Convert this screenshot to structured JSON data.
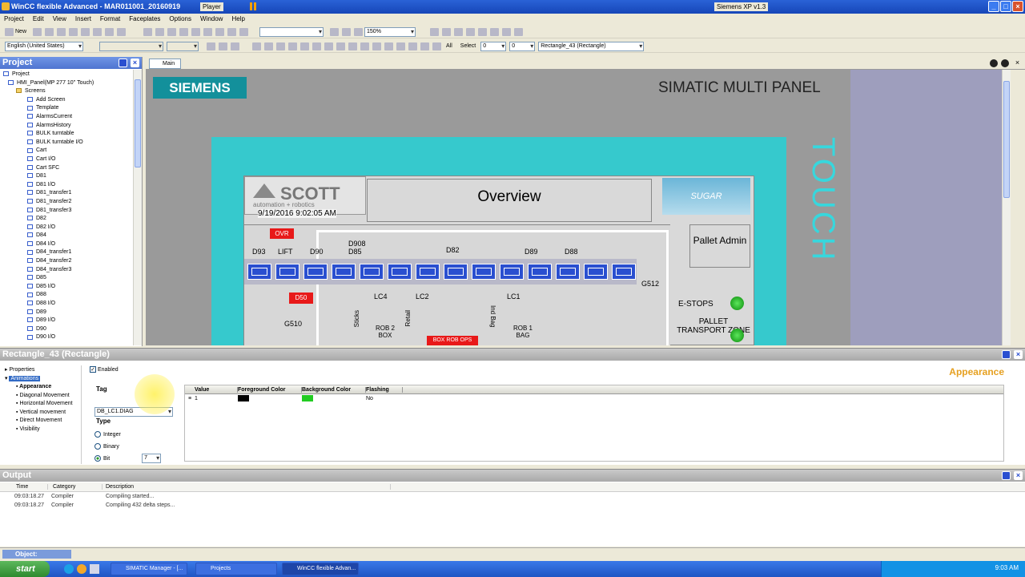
{
  "window": {
    "title": "WinCC flexible Advanced - MAR011001_20160919",
    "player_label": "Player",
    "right_title": "Siemens XP v1.3"
  },
  "menu": [
    "Project",
    "Edit",
    "View",
    "Insert",
    "Format",
    "Faceplates",
    "Options",
    "Window",
    "Help"
  ],
  "toolbar": {
    "new_label": "New",
    "zoom": "150%",
    "language": "English (United States)",
    "select_label": "Select",
    "select_val1": "0",
    "select_val2": "0",
    "object_combo": "Rectangle_43 (Rectangle)",
    "all_label": "All"
  },
  "project": {
    "header": "Project",
    "root": "Project",
    "panel": "HMI_Panel(MP 277 10'' Touch)",
    "screens_folder": "Screens",
    "items": [
      "Add Screen",
      "Template",
      "AlarmsCurrent",
      "AlarmsHistory",
      "BULK turntable",
      "BULK turntable I/O",
      "Cart",
      "Cart I/O",
      "Cart SFC",
      "D81",
      "D81 I/O",
      "D81_transfer1",
      "D81_transfer2",
      "D81_transfer3",
      "D82",
      "D82 I/O",
      "D84",
      "D84 I/O",
      "D84_transfer1",
      "D84_transfer2",
      "D84_transfer3",
      "D85",
      "D85 I/O",
      "D88",
      "D88 I/O",
      "D89",
      "D89 I/O",
      "D90",
      "D90 I/O"
    ]
  },
  "editor_tab": "Main",
  "hmi": {
    "brand": "SIEMENS",
    "panel_title": "SIMATIC MULTI PANEL",
    "touch": "TOUCH",
    "screen_title": "Overview",
    "scott": "SCOTT",
    "scott_sub": "automation + robotics",
    "datetime": "9/19/2016 9:02:05 AM",
    "sugar": "SUGAR",
    "pallet_admin": "Pallet Admin",
    "ovr": "OVR",
    "labels": {
      "d93": "D93",
      "lift": "LIFT",
      "d90": "D90",
      "d908": "D908",
      "d85": "D85",
      "d82": "D82",
      "d89": "D89",
      "d88": "D88",
      "g512": "G512",
      "lc4": "LC4",
      "lc2": "LC2",
      "lc1": "LC1",
      "g510": "G510",
      "sticks": "Sticks",
      "rob2box": "ROB 2 BOX",
      "retail": "Retail",
      "indbag": "Ind Bag",
      "rob1bag": "ROB 1 BAG",
      "estops": "E-STOPS",
      "pallet_transport": "PALLET TRANSPORT ZONE",
      "box_rob": "BOX ROB OPS",
      "d50": "D50"
    }
  },
  "properties": {
    "header": "Rectangle_43 (Rectangle)",
    "tree": {
      "properties": "Properties",
      "animations": "Animations",
      "items": [
        "Appearance",
        "Diagonal Movement",
        "Horizontal Movement",
        "Vertical movement",
        "Direct Movement",
        "Visibility"
      ]
    },
    "enabled_label": "Enabled",
    "tag_label": "Tag",
    "tag_value": "DB_LC1.DIAG",
    "type_label": "Type",
    "type_options": [
      "Integer",
      "Binary",
      "Bit"
    ],
    "bit_value": "7",
    "appearance_title": "Appearance",
    "columns": [
      "Value",
      "Foreground Color",
      "Background Color",
      "Flashing"
    ],
    "rows": [
      {
        "value": "1",
        "fg": "#000000",
        "bg": "#22cc22",
        "flashing": "No"
      }
    ]
  },
  "output": {
    "header": "Output",
    "columns": [
      "Time",
      "Category",
      "Description"
    ],
    "rows": [
      {
        "time": "09:03:18.27",
        "category": "Compiler",
        "description": "Compiling started..."
      },
      {
        "time": "09:03:18.27",
        "category": "Compiler",
        "description": "Compiling 432 delta steps..."
      }
    ]
  },
  "statusbar": {
    "object_label": "Object:"
  },
  "taskbar": {
    "start": "start",
    "tasks": [
      "SIMATIC Manager - [...",
      "Projects",
      "WinCC flexible Advan..."
    ],
    "clock": "9:03 AM"
  }
}
